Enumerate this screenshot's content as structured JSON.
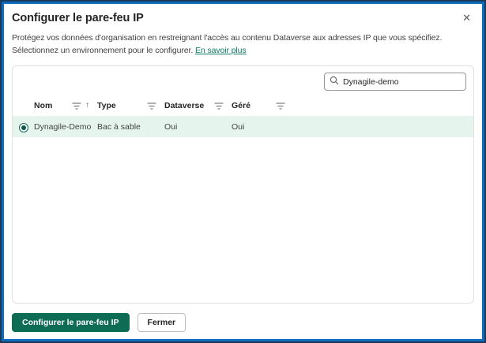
{
  "dialog": {
    "title": "Configurer le pare-feu IP",
    "close_icon": "✕",
    "description": "Protégez vos données d'organisation en restreignant l'accès au contenu Dataverse aux adresses IP que vous spécifiez. Sélectionnez un environnement pour le configurer.",
    "learn_more_label": "En savoir plus"
  },
  "search": {
    "value": "Dynagile-demo",
    "icon": "search-magnifier"
  },
  "table": {
    "columns": [
      {
        "label": "Nom",
        "filter_icon": "filter",
        "sort_icon": "↑"
      },
      {
        "label": "Type",
        "filter_icon": "filter"
      },
      {
        "label": "Dataverse",
        "filter_icon": "filter"
      },
      {
        "label": "Géré",
        "filter_icon": "filter"
      }
    ],
    "rows": [
      {
        "selected": true,
        "name": "Dynagile-Demo",
        "type": "Bac à sable",
        "dataverse": "Oui",
        "gere": "Oui"
      }
    ]
  },
  "footer": {
    "primary_label": "Configurer le pare-feu IP",
    "secondary_label": "Fermer"
  },
  "colors": {
    "frame_outer": "#1a3a5c",
    "frame_inner": "#0f6cbd",
    "primary_button": "#0e6b54",
    "link": "#0e7a63",
    "selected_row": "#e5f5ee",
    "radio": "#0d6b54"
  }
}
